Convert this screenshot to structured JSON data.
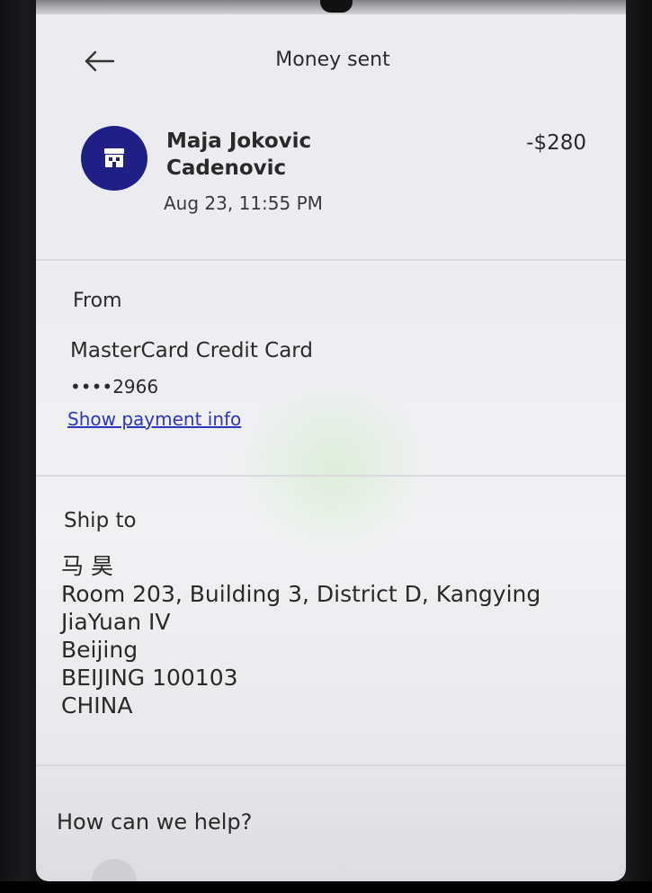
{
  "header": {
    "title": "Money sent"
  },
  "transaction": {
    "merchant_name_line1": "Maja Jokovic",
    "merchant_name_line2": "Cadenovic",
    "amount": "-$280",
    "date": "Aug 23, 11:55 PM",
    "merchant_icon": "storefront-icon"
  },
  "from_section": {
    "label": "From",
    "card_name": "MasterCard Credit Card",
    "card_number": "••••2966",
    "show_payment_info_label": "Show payment info"
  },
  "ship_to": {
    "label": "Ship to",
    "lines": [
      "马 昊",
      "Room 203, Building 3, District D, Kangying",
      "JiaYuan IV",
      "Beijing",
      "BEIJING 100103",
      "CHINA"
    ]
  },
  "help": {
    "label": "How can we help?"
  },
  "colors": {
    "avatar_bg": "#1f1f86",
    "link": "#2d37b8",
    "text": "#2a2a2a"
  }
}
